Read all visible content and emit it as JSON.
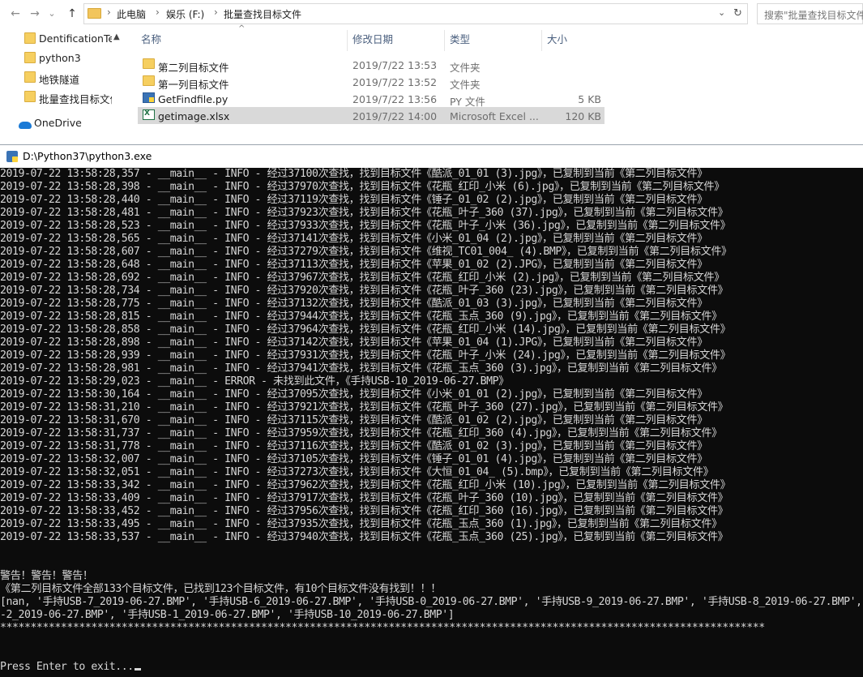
{
  "explorer": {
    "nav_back": "←",
    "nav_forward": "→",
    "nav_recent": "⌄",
    "nav_up": "↑",
    "breadcrumb": [
      "此电脑",
      "娱乐 (F:)",
      "批量查找目标文件"
    ],
    "address_dropdown": "⌄",
    "refresh": "↻",
    "search_placeholder": "搜索\"批量查找目标文件\"",
    "nav_items": [
      "DentificationTe",
      "python3",
      "地铁隧道",
      "批量查找目标文件"
    ],
    "onedrive": "OneDrive",
    "columns": {
      "name": "名称",
      "date": "修改日期",
      "type": "类型",
      "size": "大小"
    },
    "files": [
      {
        "name": "第二列目标文件",
        "date": "2019/7/22 13:53",
        "type": "文件夹",
        "size": "",
        "icon": "folder-icon"
      },
      {
        "name": "第一列目标文件",
        "date": "2019/7/22 13:52",
        "type": "文件夹",
        "size": "",
        "icon": "folder-icon"
      },
      {
        "name": "GetFindfile.py",
        "date": "2019/7/22 13:56",
        "type": "PY 文件",
        "size": "5 KB",
        "icon": "python-file-icon"
      },
      {
        "name": "getimage.xlsx",
        "date": "2019/7/22 14:00",
        "type": "Microsoft Excel ...",
        "size": "120 KB",
        "icon": "excel-file-icon"
      }
    ]
  },
  "console": {
    "title": "D:\\Python37\\python3.exe",
    "lines": [
      "2019-07-22 13:58:28,357 - __main__ - INFO - 经过37100次查找，找到目标文件《酷派_01_01 (3).jpg》，已复制到当前《第二列目标文件》",
      "2019-07-22 13:58:28,398 - __main__ - INFO - 经过37970次查找，找到目标文件《花瓶_红印_小米 (6).jpg》，已复制到当前《第二列目标文件》",
      "2019-07-22 13:58:28,440 - __main__ - INFO - 经过37119次查找，找到目标文件《锤子_01_02 (2).jpg》，已复制到当前《第二列目标文件》",
      "2019-07-22 13:58:28,481 - __main__ - INFO - 经过37923次查找，找到目标文件《花瓶_叶子_360 (37).jpg》，已复制到当前《第二列目标文件》",
      "2019-07-22 13:58:28,523 - __main__ - INFO - 经过37933次查找，找到目标文件《花瓶_叶子_小米 (36).jpg》，已复制到当前《第二列目标文件》",
      "2019-07-22 13:58:28,565 - __main__ - INFO - 经过37141次查找，找到目标文件《小米_01_04 (2).jpg》，已复制到当前《第二列目标文件》",
      "2019-07-22 13:58:28,607 - __main__ - INFO - 经过37279次查找，找到目标文件《维视_TC01_004_ (4).BMP》，已复制到当前《第二列目标文件》",
      "2019-07-22 13:58:28,648 - __main__ - INFO - 经过37113次查找，找到目标文件《苹果_01_02 (2).JPG》，已复制到当前《第二列目标文件》",
      "2019-07-22 13:58:28,692 - __main__ - INFO - 经过37967次查找，找到目标文件《花瓶_红印_小米 (2).jpg》，已复制到当前《第二列目标文件》",
      "2019-07-22 13:58:28,734 - __main__ - INFO - 经过37920次查找，找到目标文件《花瓶_叶子_360 (23).jpg》，已复制到当前《第二列目标文件》",
      "2019-07-22 13:58:28,775 - __main__ - INFO - 经过37132次查找，找到目标文件《酷派_01_03 (3).jpg》，已复制到当前《第二列目标文件》",
      "2019-07-22 13:58:28,815 - __main__ - INFO - 经过37944次查找，找到目标文件《花瓶_玉点_360 (9).jpg》，已复制到当前《第二列目标文件》",
      "2019-07-22 13:58:28,858 - __main__ - INFO - 经过37964次查找，找到目标文件《花瓶_红印_小米 (14).jpg》，已复制到当前《第二列目标文件》",
      "2019-07-22 13:58:28,898 - __main__ - INFO - 经过37142次查找，找到目标文件《苹果_01_04 (1).JPG》，已复制到当前《第二列目标文件》",
      "2019-07-22 13:58:28,939 - __main__ - INFO - 经过37931次查找，找到目标文件《花瓶_叶子_小米 (24).jpg》，已复制到当前《第二列目标文件》",
      "2019-07-22 13:58:28,981 - __main__ - INFO - 经过37941次查找，找到目标文件《花瓶_玉点_360 (3).jpg》，已复制到当前《第二列目标文件》",
      "2019-07-22 13:58:29,023 - __main__ - ERROR - 未找到此文件，《手持USB-10_2019-06-27.BMP》",
      "2019-07-22 13:58:30,164 - __main__ - INFO - 经过37095次查找，找到目标文件《小米_01_01 (2).jpg》，已复制到当前《第二列目标文件》",
      "2019-07-22 13:58:31,210 - __main__ - INFO - 经过37921次查找，找到目标文件《花瓶_叶子_360 (27).jpg》，已复制到当前《第二列目标文件》",
      "2019-07-22 13:58:31,670 - __main__ - INFO - 经过37115次查找，找到目标文件《酷派_01_02 (2).jpg》，已复制到当前《第二列目标文件》",
      "2019-07-22 13:58:31,737 - __main__ - INFO - 经过37959次查找，找到目标文件《花瓶_红印_360 (4).jpg》，已复制到当前《第二列目标文件》",
      "2019-07-22 13:58:31,778 - __main__ - INFO - 经过37116次查找，找到目标文件《酷派_01_02 (3).jpg》，已复制到当前《第二列目标文件》",
      "2019-07-22 13:58:32,007 - __main__ - INFO - 经过37105次查找，找到目标文件《锤子_01_01 (4).jpg》，已复制到当前《第二列目标文件》",
      "2019-07-22 13:58:32,051 - __main__ - INFO - 经过37273次查找，找到目标文件《大恒_01_04_ (5).bmp》，已复制到当前《第二列目标文件》",
      "2019-07-22 13:58:33,342 - __main__ - INFO - 经过37962次查找，找到目标文件《花瓶_红印_小米 (10).jpg》，已复制到当前《第二列目标文件》",
      "2019-07-22 13:58:33,409 - __main__ - INFO - 经过37917次查找，找到目标文件《花瓶_叶子_360 (10).jpg》，已复制到当前《第二列目标文件》",
      "2019-07-22 13:58:33,452 - __main__ - INFO - 经过37956次查找，找到目标文件《花瓶_红印_360 (16).jpg》，已复制到当前《第二列目标文件》",
      "2019-07-22 13:58:33,495 - __main__ - INFO - 经过37935次查找，找到目标文件《花瓶_玉点_360 (1).jpg》，已复制到当前《第二列目标文件》",
      "2019-07-22 13:58:33,537 - __main__ - INFO - 经过37940次查找，找到目标文件《花瓶_玉点_360 (25).jpg》，已复制到当前《第二列目标文件》",
      "",
      "",
      "警告！警告！警告！",
      "《第二列目标文件全部133个目标文件，已找到123个目标文件，有10个目标文件没有找到！！！",
      "[nan, '手持USB-7_2019-06-27.BMP', '手持USB-6_2019-06-27.BMP', '手持USB-0_2019-06-27.BMP', '手持USB-9_2019-06-27.BMP', '手持USB-8_2019-06-27.BMP', '手持USB-",
      "-2_2019-06-27.BMP', '手持USB-1_2019-06-27.BMP', '手持USB-10_2019-06-27.BMP']",
      "******************************************************************************************************************************",
      "",
      "",
      "Press Enter to exit..."
    ]
  }
}
